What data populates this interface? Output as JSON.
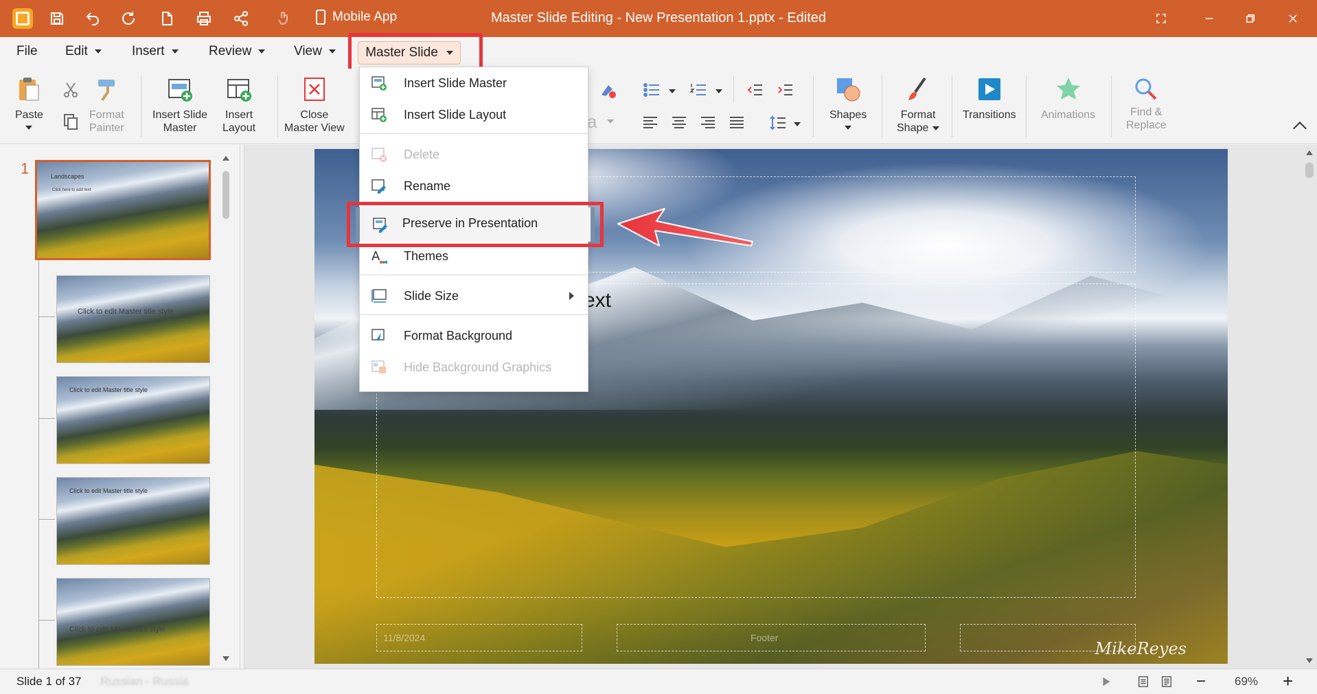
{
  "window": {
    "title": "Master Slide Editing - New Presentation 1.pptx - Edited",
    "mobile_app": "Mobile App"
  },
  "menubar": {
    "file": "File",
    "edit": "Edit",
    "insert": "Insert",
    "review": "Review",
    "view": "View",
    "master_slide": "Master Slide"
  },
  "ribbon": {
    "paste": "Paste",
    "format_painter_1": "Format",
    "format_painter_2": "Painter",
    "insert_slide_master_1": "Insert Slide",
    "insert_slide_master_2": "Master",
    "insert_layout_1": "Insert",
    "insert_layout_2": "Layout",
    "close_master_1": "Close",
    "close_master_2": "Master View",
    "shapes": "Shapes",
    "format_shape_1": "Format",
    "format_shape_2": "Shape",
    "transitions": "Transitions",
    "animations": "Animations",
    "find_replace_1": "Find &",
    "find_replace_2": "Replace"
  },
  "dropdown": {
    "items": [
      {
        "label": "Insert Slide Master",
        "enabled": true
      },
      {
        "label": "Insert Slide Layout",
        "enabled": true
      },
      {
        "label": "Delete",
        "enabled": false
      },
      {
        "label": "Rename",
        "enabled": true
      },
      {
        "label": "Preserve in Presentation",
        "enabled": true,
        "highlighted": true
      },
      {
        "label": "Themes",
        "enabled": true
      },
      {
        "label": "Slide Size",
        "enabled": true,
        "submenu": true
      },
      {
        "label": "Format Background",
        "enabled": true
      },
      {
        "label": "Hide Background Graphics",
        "enabled": false
      }
    ]
  },
  "slide_panel": {
    "selected_number": "1",
    "thumbs": [
      {
        "title": "Landscapes",
        "sub": "Click here to add text"
      },
      {
        "title": "",
        "sub": "Click to edit Master title style"
      },
      {
        "title": "Click to edit Master title style",
        "sub": ""
      },
      {
        "title": "Click to edit Master title style",
        "sub": ""
      },
      {
        "title": "",
        "sub": "Click to edit Master title style"
      }
    ]
  },
  "slide": {
    "visible_text": "ext",
    "signature": "MikeReyes",
    "date_placeholder": "11/8/2024",
    "footer_placeholder": "Footer"
  },
  "status": {
    "slide_count": "Slide 1 of 37",
    "language": "Russian - Russia",
    "zoom": "69%",
    "zoom_minus": "−",
    "zoom_plus": "+"
  },
  "colors": {
    "accent": "#d2602c",
    "highlight": "#e8343c"
  }
}
